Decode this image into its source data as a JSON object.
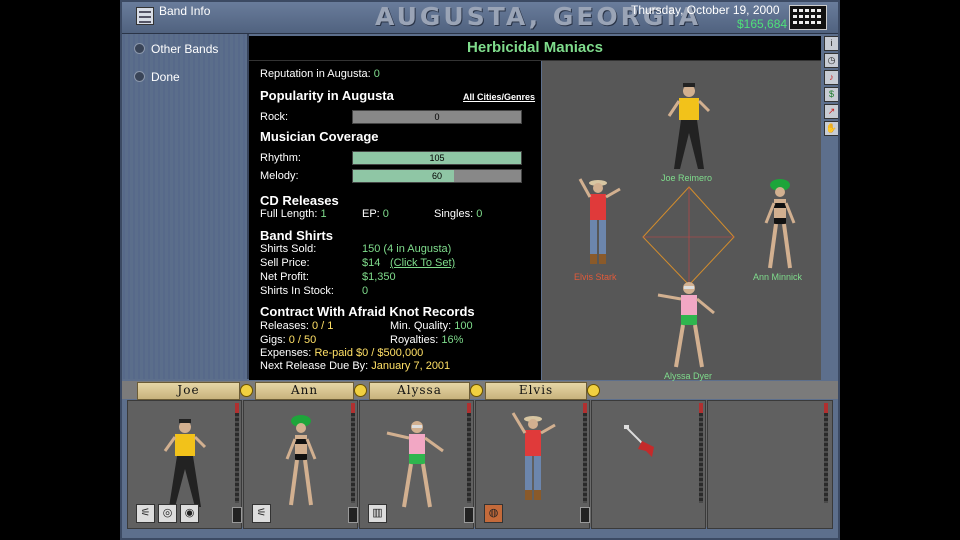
{
  "topbar": {
    "menu_label": "Band Info",
    "city": "AUGUSTA, GEORGIA",
    "date": "Thursday, October 19, 2000",
    "money": "$165,684"
  },
  "sidebar": {
    "items": [
      {
        "label": "Other Bands"
      },
      {
        "label": "Done"
      }
    ]
  },
  "band": {
    "name": "Herbicidal Maniacs"
  },
  "reputation": {
    "label": "Reputation in Augusta:",
    "value": "0"
  },
  "popularity": {
    "heading": "Popularity in Augusta",
    "link": "All Cities/Genres",
    "genre_label": "Rock:",
    "genre_value": "0",
    "genre_fraction": 0
  },
  "coverage": {
    "heading": "Musician Coverage",
    "rhythm_label": "Rhythm:",
    "rhythm_value": "105",
    "rhythm_fraction": 1.0,
    "melody_label": "Melody:",
    "melody_value": "60",
    "melody_fraction": 0.6
  },
  "cd": {
    "heading": "CD Releases",
    "full_label": "Full Length:",
    "full_value": "1",
    "ep_label": "EP:",
    "ep_value": "0",
    "singles_label": "Singles:",
    "singles_value": "0"
  },
  "shirts": {
    "heading": "Band Shirts",
    "sold_label": "Shirts Sold:",
    "sold_value": "150 (4 in Augusta)",
    "price_label": "Sell Price:",
    "price_value": "$14",
    "price_link": "(Click To Set)",
    "profit_label": "Net Profit:",
    "profit_value": "$1,350",
    "stock_label": "Shirts In Stock:",
    "stock_value": "0"
  },
  "contract": {
    "heading": "Contract With Afraid Knot Records",
    "releases_label": "Releases:",
    "releases_value": "0 / 1",
    "quality_label": "Min. Quality:",
    "quality_value": "100",
    "gigs_label": "Gigs:",
    "gigs_value": "0 / 50",
    "royalties_label": "Royalties:",
    "royalties_value": "16%",
    "expenses_label": "Expenses:",
    "expenses_value": "Re-paid $0 / $500,000",
    "due_label": "Next Release Due By:",
    "due_value": "January 7, 2001"
  },
  "stage": {
    "members": [
      {
        "name": "Joe Reimero",
        "color": "#7fdc8c"
      },
      {
        "name": "Elvis Stark",
        "color": "#e05a3a"
      },
      {
        "name": "Ann Minnick",
        "color": "#7fdc8c"
      },
      {
        "name": "Alyssa Dyer",
        "color": "#7fdc8c"
      }
    ]
  },
  "roster": {
    "tabs": [
      {
        "name": "Joe"
      },
      {
        "name": "Ann"
      },
      {
        "name": "Alyssa"
      },
      {
        "name": "Elvis"
      }
    ]
  },
  "colors": {
    "accent_green": "#7fdc8c",
    "highlight_yellow": "#ffe066",
    "panel_blue": "#5d6f8c"
  }
}
